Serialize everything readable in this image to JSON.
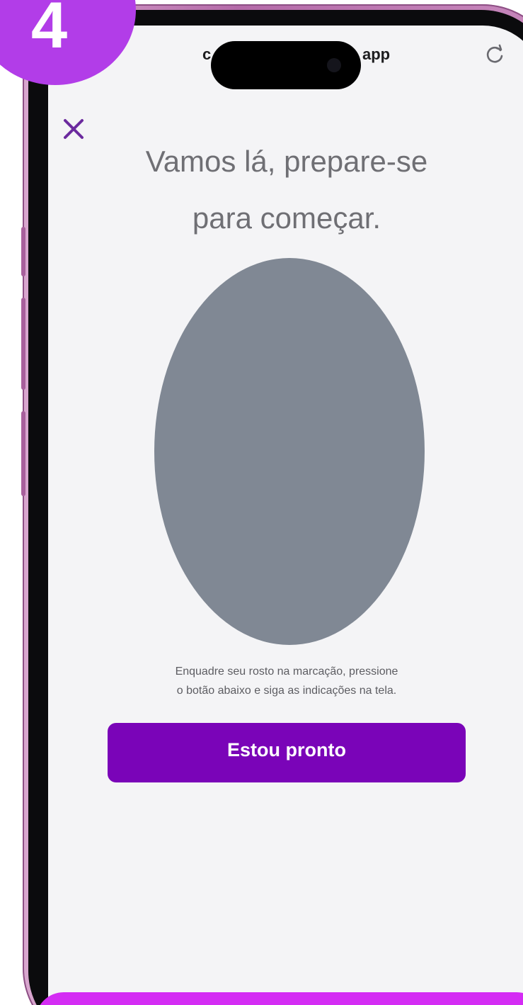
{
  "step": {
    "number": "4"
  },
  "browser": {
    "url_left": "c",
    "url_right": "app"
  },
  "screen": {
    "title_line1": "Vamos lá, prepare-se",
    "title_line2": "para começar.",
    "instructions_line1": "Enquadre seu rosto na marcação, pressione",
    "instructions_line2": "o botão abaixo e siga as indicações na tela.",
    "button_label": "Estou pronto"
  },
  "icons": {
    "close": "close-icon",
    "reload": "reload-icon"
  },
  "colors": {
    "accent": "#7a04b8",
    "badge": "#b23de8",
    "oval": "#808894",
    "screen_bg": "#f4f4f6"
  }
}
